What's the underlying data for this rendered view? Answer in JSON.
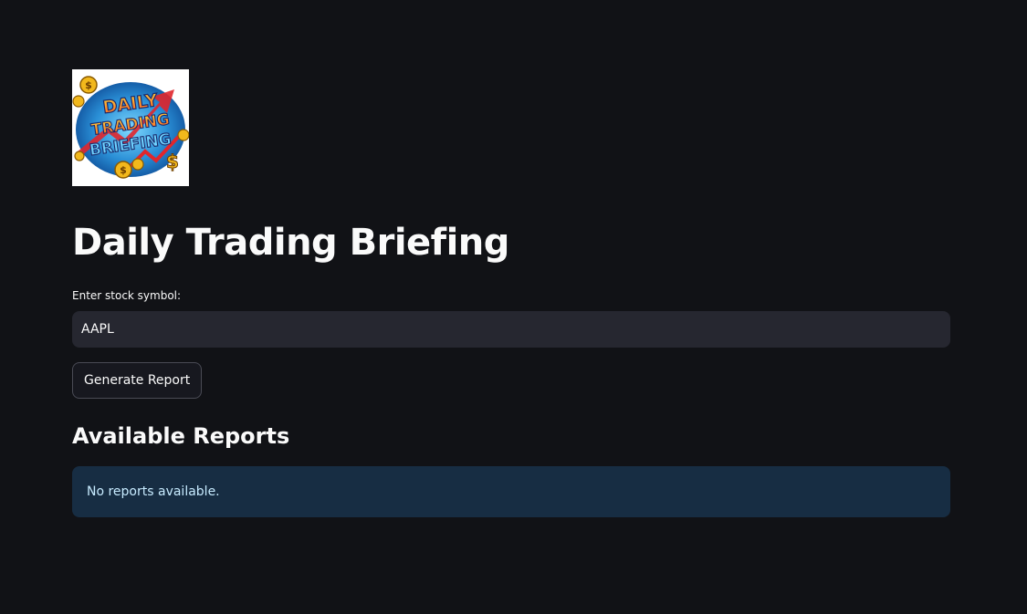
{
  "logo": {
    "alt": "Daily Trading Briefing logo",
    "lines": [
      "DAILY",
      "TRADING",
      "BRIEFING"
    ],
    "coin_symbol": "$"
  },
  "page": {
    "title": "Daily Trading Briefing"
  },
  "symbol_input": {
    "label": "Enter stock symbol:",
    "value": "AAPL"
  },
  "generate_button": {
    "label": "Generate Report"
  },
  "reports": {
    "heading": "Available Reports",
    "empty_message": "No reports available."
  },
  "colors": {
    "background": "#111216",
    "input_background": "#262730",
    "info_background": "#172d43",
    "info_text": "#c7ebff"
  }
}
